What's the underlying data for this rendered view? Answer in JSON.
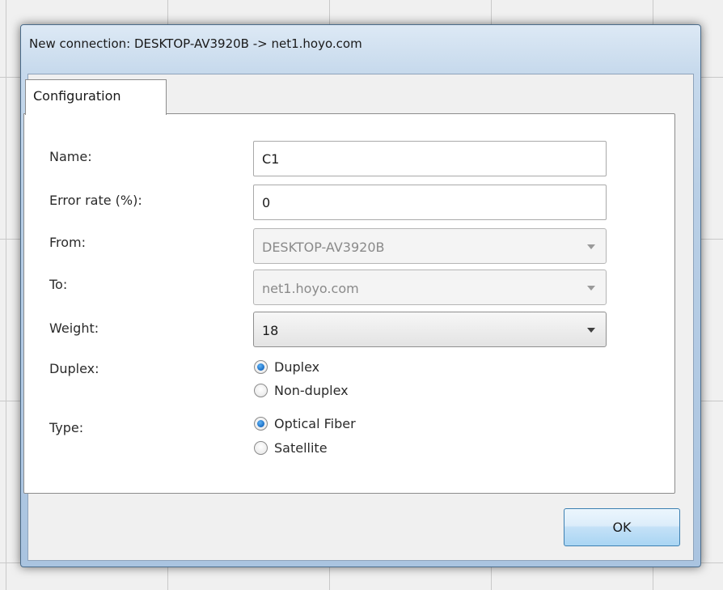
{
  "window": {
    "title": "New connection: DESKTOP-AV3920B -> net1.hoyo.com"
  },
  "tabs": [
    {
      "label": "Configuration",
      "selected": true
    }
  ],
  "form": {
    "name": {
      "label": "Name:",
      "value": "C1"
    },
    "error_rate": {
      "label": "Error rate (%):",
      "value": "0"
    },
    "from": {
      "label": "From:",
      "value": "DESKTOP-AV3920B",
      "enabled": false
    },
    "to": {
      "label": "To:",
      "value": "net1.hoyo.com",
      "enabled": false
    },
    "weight": {
      "label": "Weight:",
      "value": "18",
      "enabled": true
    },
    "duplex": {
      "label": "Duplex:",
      "options": [
        {
          "label": "Duplex",
          "checked": true
        },
        {
          "label": "Non-duplex",
          "checked": false
        }
      ]
    },
    "type": {
      "label": "Type:",
      "options": [
        {
          "label": "Optical Fiber",
          "checked": true
        },
        {
          "label": "Satellite",
          "checked": false
        }
      ]
    }
  },
  "buttons": {
    "ok_label": "OK"
  },
  "colors": {
    "radio_checked": "#1a6dc4",
    "ok_button": "#a9d5f3",
    "window_frame": "#b9cfe6"
  }
}
